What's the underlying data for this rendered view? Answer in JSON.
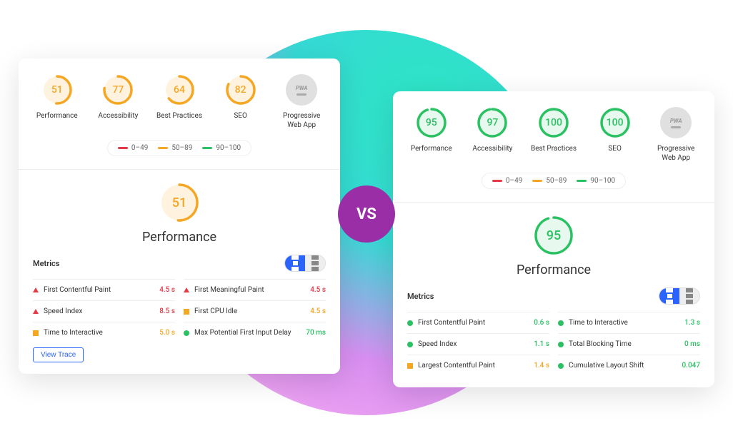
{
  "colors": {
    "red": "#e63946",
    "orange": "#f5a623",
    "green": "#2ac162"
  },
  "vs_label": "VS",
  "legend": [
    {
      "range": "0–49",
      "color": "#e63946"
    },
    {
      "range": "50–89",
      "color": "#f5a623"
    },
    {
      "range": "90–100",
      "color": "#2ac162"
    }
  ],
  "left": {
    "gauges": [
      {
        "label": "Performance",
        "score": 51,
        "color": "orange"
      },
      {
        "label": "Accessibility",
        "score": 77,
        "color": "orange"
      },
      {
        "label": "Best Practices",
        "score": 64,
        "color": "orange"
      },
      {
        "label": "SEO",
        "score": 82,
        "color": "orange"
      }
    ],
    "pwa_label": "Progressive Web App",
    "big": {
      "score": 51,
      "title": "Performance",
      "color": "orange"
    },
    "metrics_label": "Metrics",
    "metrics": {
      "col1": [
        {
          "name": "First Contentful Paint",
          "value": "4.5 s",
          "status": "red"
        },
        {
          "name": "Speed Index",
          "value": "8.5 s",
          "status": "red"
        },
        {
          "name": "Time to Interactive",
          "value": "5.0 s",
          "status": "orange"
        }
      ],
      "col2": [
        {
          "name": "First Meaningful Paint",
          "value": "4.5 s",
          "status": "red"
        },
        {
          "name": "First CPU Idle",
          "value": "4.5 s",
          "status": "orange"
        },
        {
          "name": "Max Potential First Input Delay",
          "value": "70 ms",
          "status": "green"
        }
      ]
    },
    "view_trace": "View Trace"
  },
  "right": {
    "gauges": [
      {
        "label": "Performance",
        "score": 95,
        "color": "green"
      },
      {
        "label": "Accessibility",
        "score": 97,
        "color": "green"
      },
      {
        "label": "Best Practices",
        "score": 100,
        "color": "green"
      },
      {
        "label": "SEO",
        "score": 100,
        "color": "green"
      }
    ],
    "pwa_label": "Progressive Web App",
    "big": {
      "score": 95,
      "title": "Performance",
      "color": "green"
    },
    "metrics_label": "Metrics",
    "metrics": {
      "col1": [
        {
          "name": "First Contentful Paint",
          "value": "0.6 s",
          "status": "green"
        },
        {
          "name": "Speed Index",
          "value": "1.1 s",
          "status": "green"
        },
        {
          "name": "Largest Contentful Paint",
          "value": "1.4 s",
          "status": "orange"
        }
      ],
      "col2": [
        {
          "name": "Time to Interactive",
          "value": "1.3 s",
          "status": "green"
        },
        {
          "name": "Total Blocking Time",
          "value": "0 ms",
          "status": "green"
        },
        {
          "name": "Cumulative Layout Shift",
          "value": "0.047",
          "status": "green"
        }
      ]
    }
  }
}
